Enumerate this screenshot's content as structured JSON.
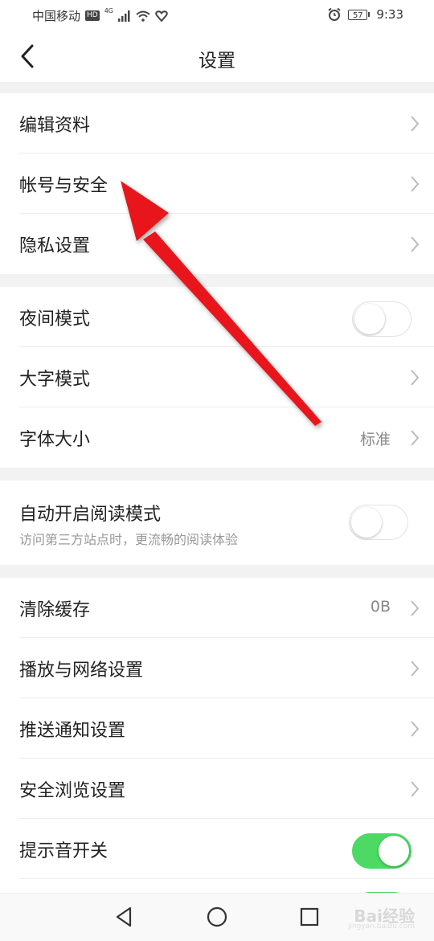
{
  "status_bar": {
    "carrier": "中国移动",
    "hd": "HD",
    "network": "4G",
    "battery": "57",
    "time": "9:33"
  },
  "nav": {
    "title": "设置",
    "back_icon": "chevron-left-icon"
  },
  "sections": {
    "profile": {
      "edit_profile": "编辑资料",
      "account_security": "帐号与安全",
      "privacy": "隐私设置"
    },
    "display": {
      "night_mode": "夜间模式",
      "night_mode_on": false,
      "large_text": "大字模式",
      "font_size": "字体大小",
      "font_size_value": "标准"
    },
    "reading": {
      "auto_reading": "自动开启阅读模式",
      "auto_reading_desc": "访问第三方站点时，更流畅的阅读体验",
      "auto_reading_on": false
    },
    "other": {
      "clear_cache": "清除缓存",
      "cache_value": "0B",
      "playback_network": "播放与网络设置",
      "push_notification": "推送通知设置",
      "safe_browsing": "安全浏览设置",
      "sound_toggle": "提示音开关",
      "sound_toggle_on": true
    }
  },
  "system_nav": {
    "back": "triangle-back-icon",
    "home": "circle-home-icon",
    "recent": "square-recent-icon"
  },
  "watermark": {
    "text": "Bai经验",
    "sub": "jingyan.baidu.com"
  },
  "colors": {
    "toggle_on": "#4cd964",
    "arrow": "#e8191f",
    "section_gap": "#f2f2f2"
  }
}
